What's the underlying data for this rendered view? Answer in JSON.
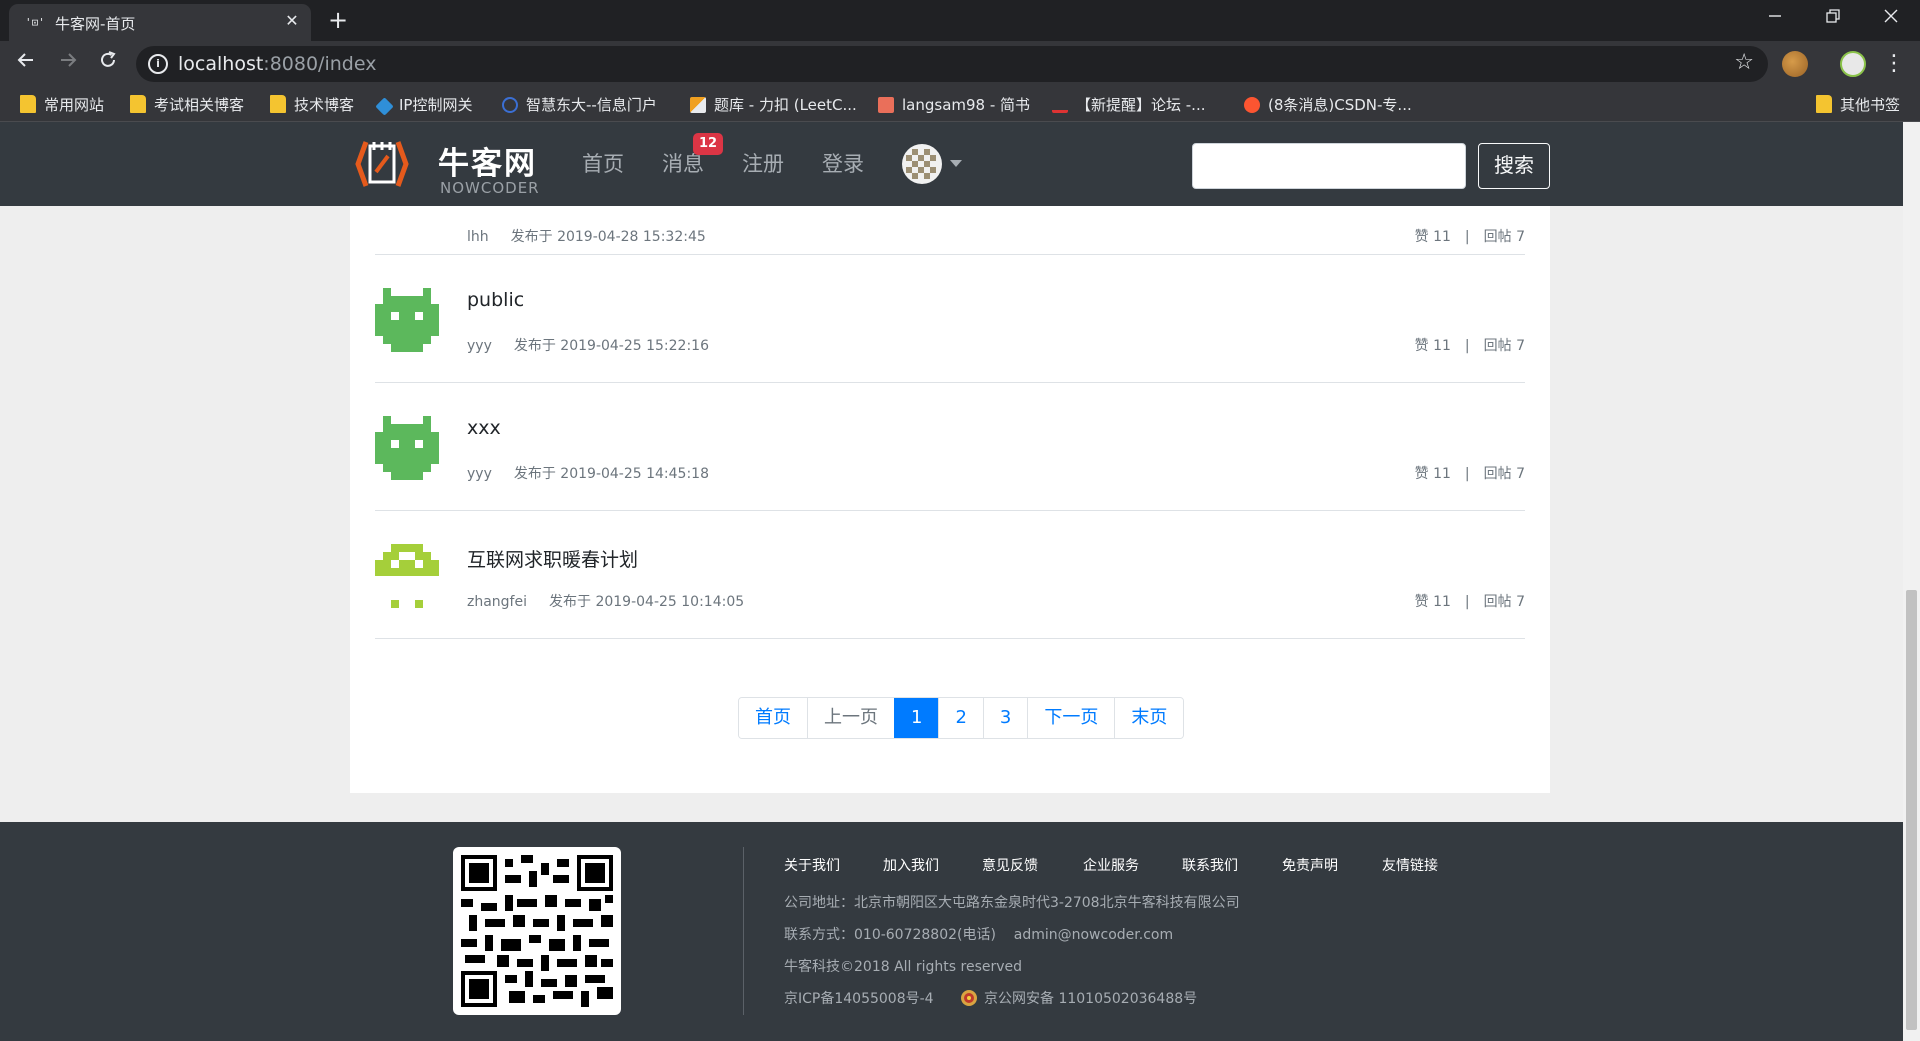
{
  "browser": {
    "tab_favicon": "'⊡'",
    "tab_title": "牛客网-首页",
    "tab_close": "✕",
    "new_tab": "+",
    "url_host": "localhost",
    "url_rest": ":8080/index",
    "bookmarks": [
      "常用网站",
      "考试相关博客",
      "技术博客",
      "IP控制网关",
      "智慧东大--信息门户",
      "题库 - 力扣 (LeetC...",
      "langsam98 - 简书",
      "【新提醒】论坛 -...",
      "(8条消息)CSDN-专...",
      "其他书签"
    ]
  },
  "site": {
    "logo_text": "牛客网",
    "logo_sub": "NOWCODER",
    "nav": {
      "home": "首页",
      "messages": "消息",
      "message_count": "12",
      "register": "注册",
      "login": "登录"
    },
    "search_button": "搜索"
  },
  "posts": [
    {
      "title": "",
      "author": "lhh",
      "time": "发布于 2019-04-28 15:32:45",
      "likes": "赞 11",
      "replies": "回帖 7",
      "stat_sep": "|"
    },
    {
      "title": "public",
      "author": "yyy",
      "time": "发布于 2019-04-25 15:22:16",
      "likes": "赞 11",
      "replies": "回帖 7",
      "stat_sep": "|"
    },
    {
      "title": "xxx",
      "author": "yyy",
      "time": "发布于 2019-04-25 14:45:18",
      "likes": "赞 11",
      "replies": "回帖 7",
      "stat_sep": "|"
    },
    {
      "title": "互联网求职暖春计划",
      "author": "zhangfei",
      "time": "发布于 2019-04-25 10:14:05",
      "likes": "赞 11",
      "replies": "回帖 7",
      "stat_sep": "|"
    }
  ],
  "pagination": {
    "first": "首页",
    "prev": "上一页",
    "pages": [
      "1",
      "2",
      "3"
    ],
    "next": "下一页",
    "last": "末页"
  },
  "footer": {
    "links": [
      "关于我们",
      "加入我们",
      "意见反馈",
      "企业服务",
      "联系我们",
      "免责声明",
      "友情链接"
    ],
    "address": "公司地址：北京市朝阳区大屯路东金泉时代3-2708北京牛客科技有限公司",
    "contact": "联系方式：010-60728802(电话)    admin@nowcoder.com",
    "copyright": "牛客科技©2018 All rights reserved",
    "icp": "京ICP备14055008号-4",
    "police": "京公网安备 11010502036488号"
  }
}
